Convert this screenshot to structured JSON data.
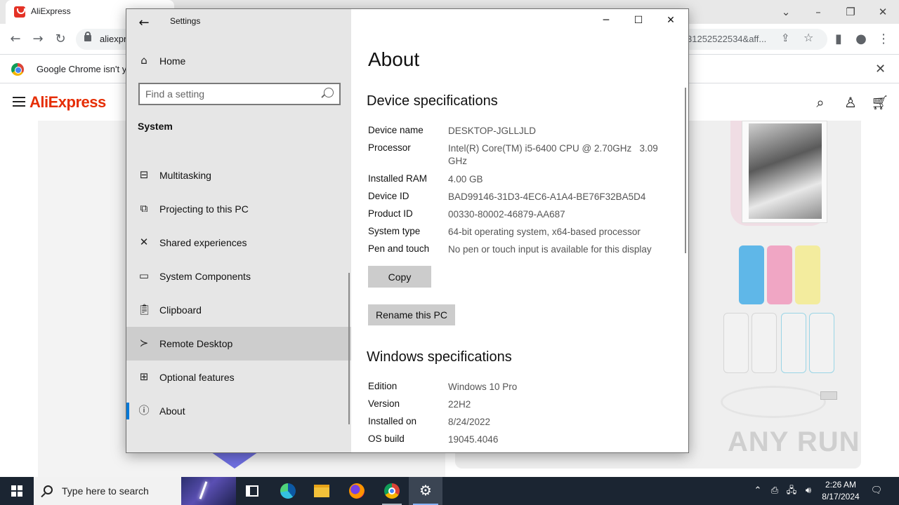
{
  "browser": {
    "tab_title": "AliExpress",
    "url_visible": "aliexpr",
    "url_tail": "31252522534&aff...",
    "infobar_message": "Google Chrome isn't y"
  },
  "aliexpress": {
    "logo_text": "AliExpress"
  },
  "settings": {
    "window_title": "Settings",
    "nav": {
      "home_label": "Home",
      "search_placeholder": "Find a setting",
      "section_label": "System",
      "items": [
        {
          "label": "Multitasking",
          "icon": "multitasking-icon"
        },
        {
          "label": "Projecting to this PC",
          "icon": "projecting-icon"
        },
        {
          "label": "Shared experiences",
          "icon": "shared-experiences-icon"
        },
        {
          "label": "System Components",
          "icon": "system-components-icon"
        },
        {
          "label": "Clipboard",
          "icon": "clipboard-icon"
        },
        {
          "label": "Remote Desktop",
          "icon": "remote-desktop-icon"
        },
        {
          "label": "Optional features",
          "icon": "optional-features-icon"
        },
        {
          "label": "About",
          "icon": "info-icon"
        }
      ],
      "selected": "About",
      "hovered": "Remote Desktop"
    },
    "main": {
      "page_title": "About",
      "device_section_title": "Device specifications",
      "device_specs": [
        {
          "key": "Device name",
          "value": "DESKTOP-JGLLJLD"
        },
        {
          "key": "Processor",
          "value": "Intel(R) Core(TM) i5-6400 CPU @ 2.70GHz   3.09 GHz"
        },
        {
          "key": "Installed RAM",
          "value": "4.00 GB"
        },
        {
          "key": "Device ID",
          "value": "BAD99146-31D3-4EC6-A1A4-BE76F32BA5D4"
        },
        {
          "key": "Product ID",
          "value": "00330-80002-46879-AA687"
        },
        {
          "key": "System type",
          "value": "64-bit operating system, x64-based processor"
        },
        {
          "key": "Pen and touch",
          "value": "No pen or touch input is available for this display"
        }
      ],
      "copy_button": "Copy",
      "rename_button": "Rename this PC",
      "windows_section_title": "Windows specifications",
      "windows_specs": [
        {
          "key": "Edition",
          "value": "Windows 10 Pro"
        },
        {
          "key": "Version",
          "value": "22H2"
        },
        {
          "key": "Installed on",
          "value": "8/24/2022"
        },
        {
          "key": "OS build",
          "value": "19045.4046"
        }
      ]
    }
  },
  "taskbar": {
    "search_placeholder": "Type here to search",
    "time": "2:26 AM",
    "date": "8/17/2024",
    "apps": [
      "task-view-icon",
      "edge-icon",
      "file-explorer-icon",
      "firefox-icon",
      "chrome-icon",
      "settings-gear-icon"
    ]
  },
  "watermark": "ANY RUN"
}
